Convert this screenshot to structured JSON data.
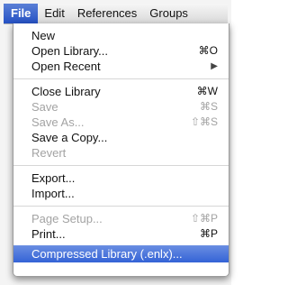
{
  "menubar": {
    "items": [
      {
        "label": "File",
        "active": true
      },
      {
        "label": "Edit"
      },
      {
        "label": "References"
      },
      {
        "label": "Groups"
      }
    ]
  },
  "file_menu": {
    "items": [
      {
        "label": "New",
        "shortcut": "",
        "enabled": true
      },
      {
        "label": "Open Library...",
        "shortcut": "⌘O",
        "enabled": true
      },
      {
        "label": "Open Recent",
        "shortcut": "▶",
        "enabled": true
      },
      {
        "label": "Close Library",
        "shortcut": "⌘W",
        "enabled": true
      },
      {
        "label": "Save",
        "shortcut": "⌘S",
        "enabled": false
      },
      {
        "label": "Save As...",
        "shortcut": "⇧⌘S",
        "enabled": false
      },
      {
        "label": "Save a Copy...",
        "shortcut": "",
        "enabled": true
      },
      {
        "label": "Revert",
        "shortcut": "",
        "enabled": false
      },
      {
        "label": "Export...",
        "shortcut": "",
        "enabled": true
      },
      {
        "label": "Import...",
        "shortcut": "",
        "enabled": true
      },
      {
        "label": "Page Setup...",
        "shortcut": "⇧⌘P",
        "enabled": false
      },
      {
        "label": "Print...",
        "shortcut": "⌘P",
        "enabled": true
      },
      {
        "label": "Compressed Library (.enlx)...",
        "shortcut": "",
        "enabled": true,
        "highlighted": true
      }
    ]
  },
  "colors": {
    "highlight": "#3463d6",
    "disabled_text": "#a3a3a3"
  }
}
